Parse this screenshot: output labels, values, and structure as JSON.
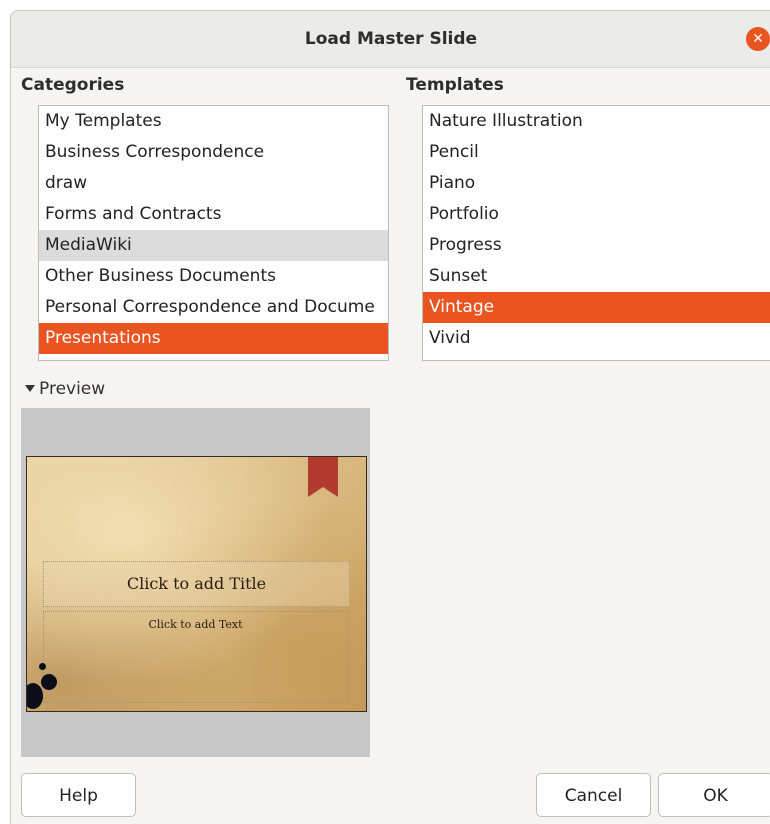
{
  "dialog": {
    "title": "Load Master Slide"
  },
  "categories": {
    "label": "Categories",
    "items": [
      "My Templates",
      "Business Correspondence",
      "draw",
      "Forms and Contracts",
      "MediaWiki",
      "Other Business Documents",
      "Personal Correspondence and Docume",
      "Presentations"
    ],
    "hovered": "MediaWiki",
    "selected": "Presentations"
  },
  "templates": {
    "label": "Templates",
    "items": [
      "Nature Illustration",
      "Pencil",
      "Piano",
      "Portfolio",
      "Progress",
      "Sunset",
      "Vintage",
      "Vivid"
    ],
    "selected": "Vintage"
  },
  "preview": {
    "label": "Preview",
    "slide_title": "Click to add Title",
    "slide_text": "Click to add Text"
  },
  "buttons": {
    "help": "Help",
    "cancel": "Cancel",
    "ok": "OK"
  },
  "colors": {
    "accent": "#e95420",
    "ribbon": "#b23a2e"
  }
}
